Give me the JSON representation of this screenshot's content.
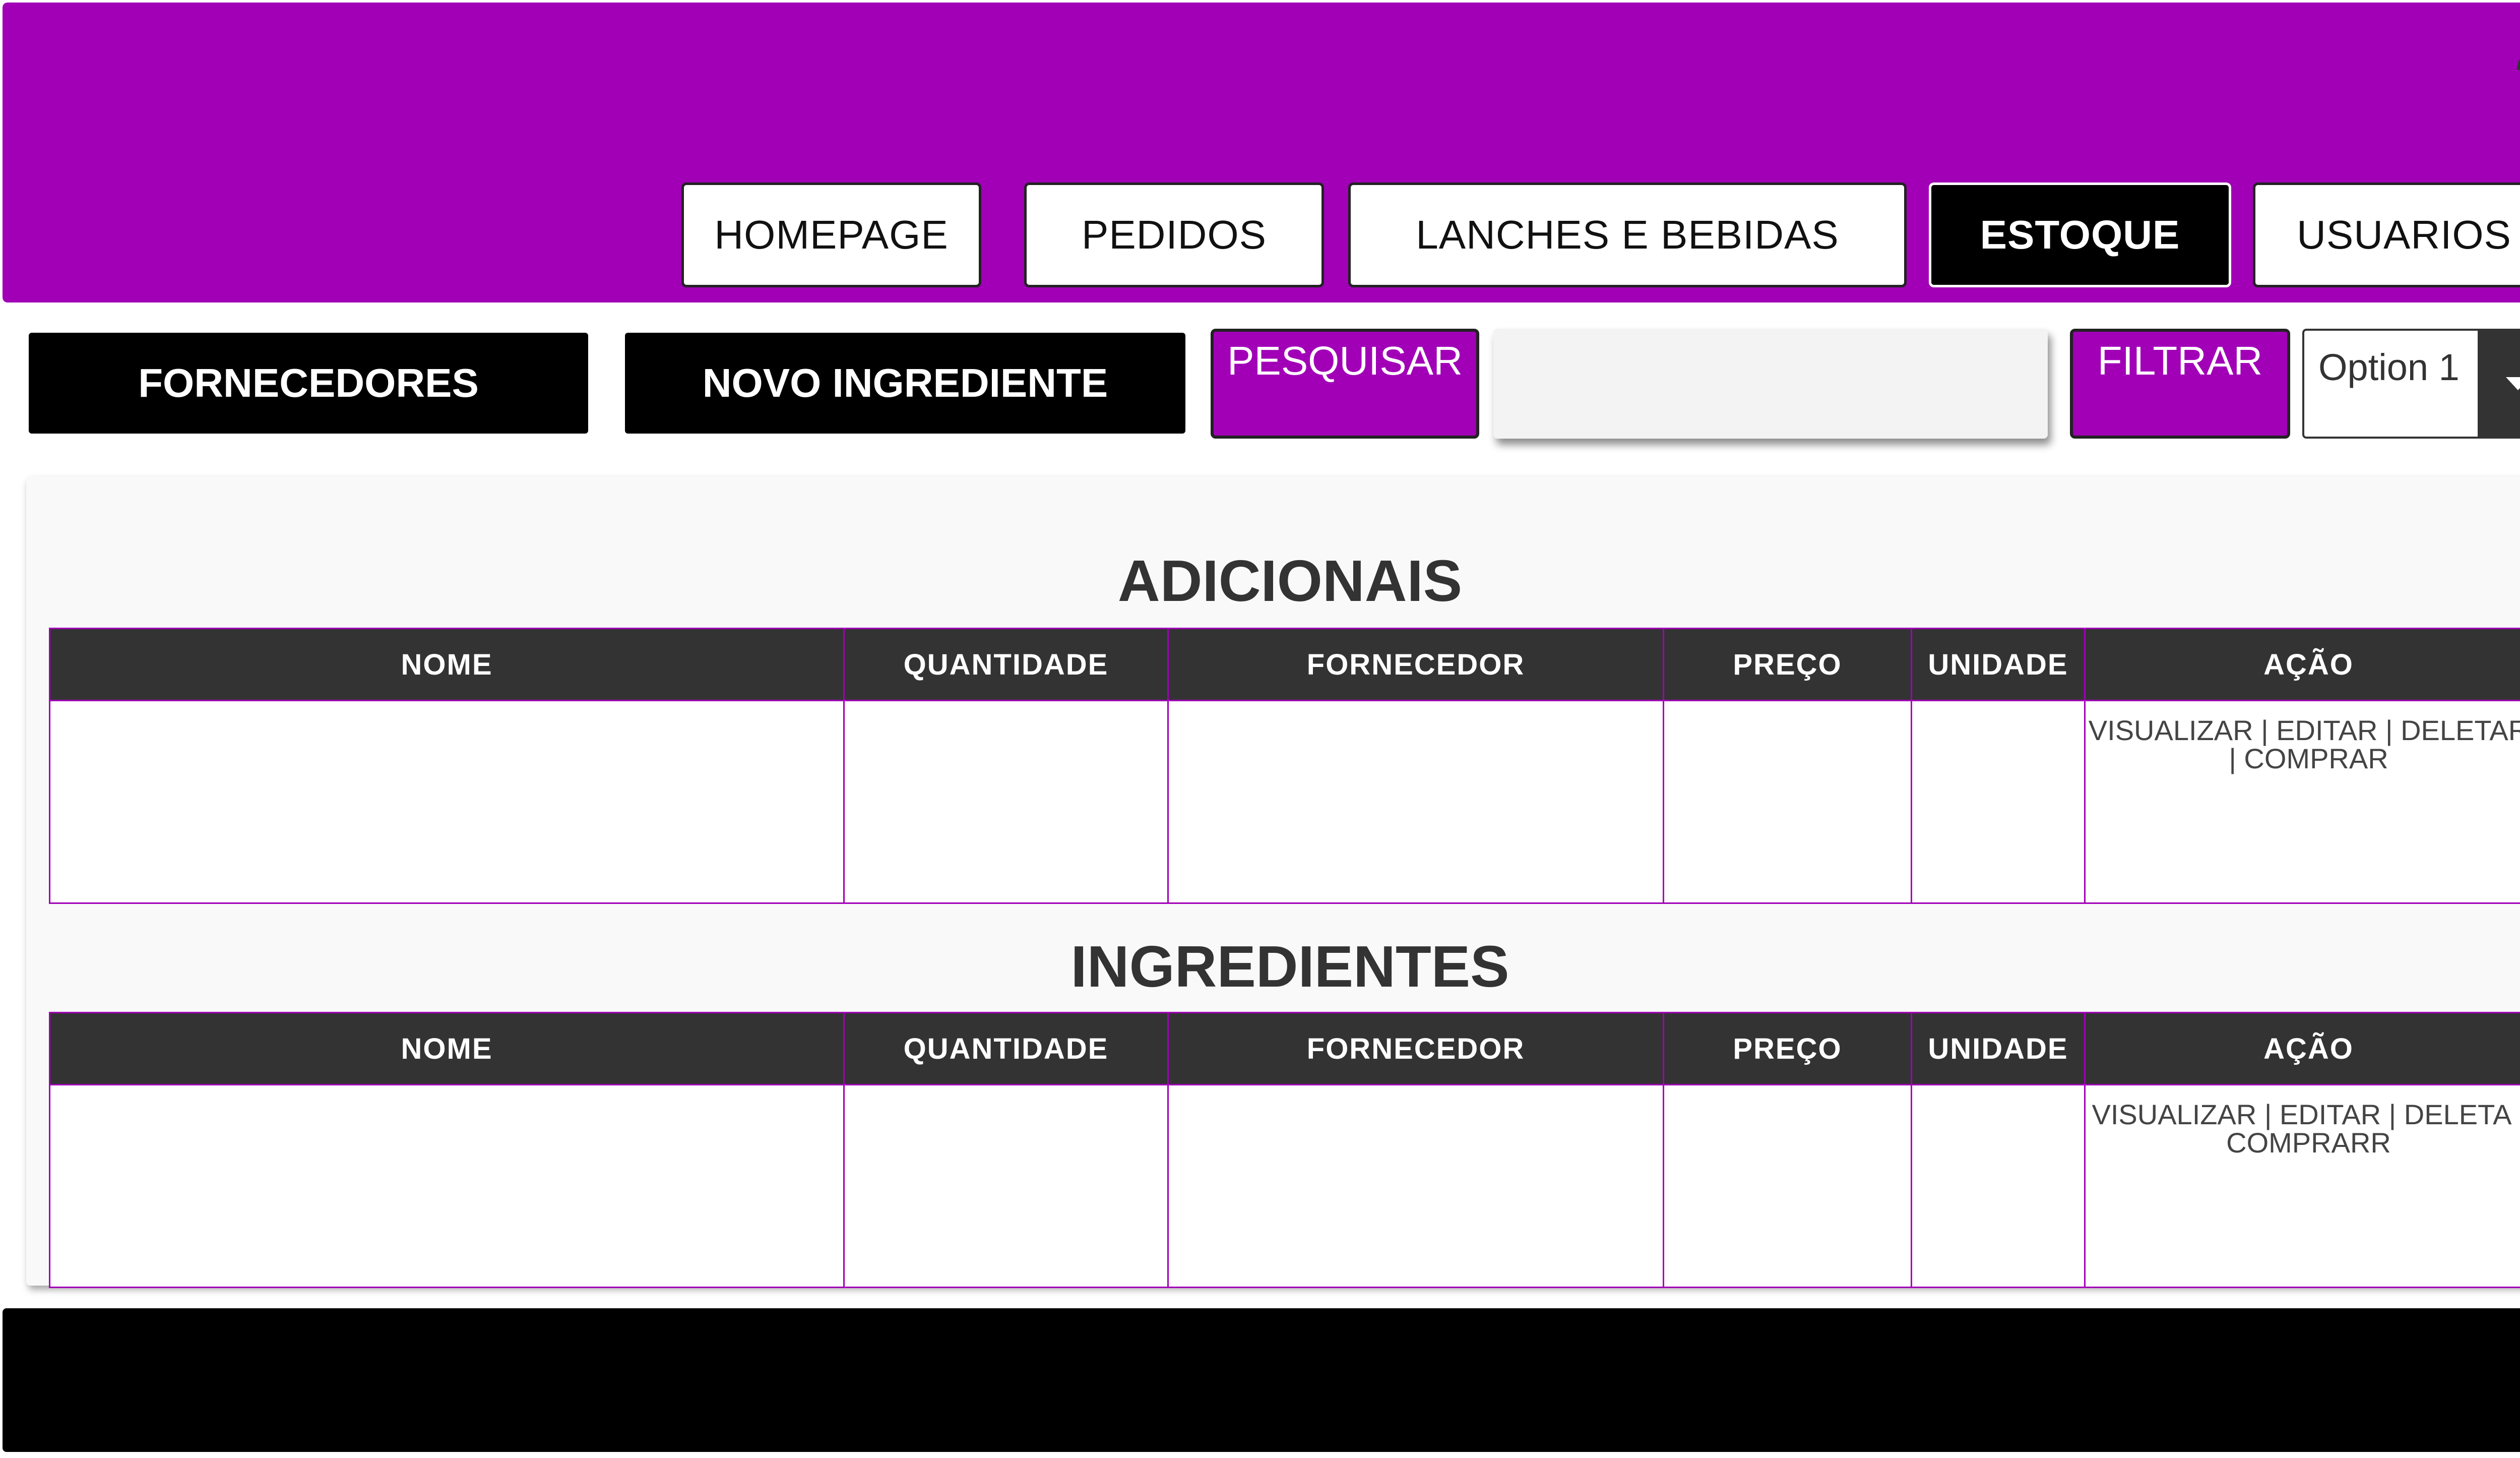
{
  "header": {
    "nav": [
      {
        "label": "HOMEPAGE",
        "active": false
      },
      {
        "label": "PEDIDOS",
        "active": false
      },
      {
        "label": "LANCHES E BEBIDAS",
        "active": false
      },
      {
        "label": "ESTOQUE",
        "active": true
      },
      {
        "label": "USUARIOS",
        "active": false
      }
    ],
    "user_icon": "user-icon"
  },
  "toolbar": {
    "fornecedores_label": "FORNECEDORES",
    "novo_ingrediente_label": "NOVO INGREDIENTE",
    "pesquisar_label": "PESQUISAR",
    "search_value": "",
    "filtrar_label": "FILTRAR",
    "filter_select": {
      "selected": "Option 1"
    }
  },
  "sections": [
    {
      "title": "ADICIONAIS",
      "columns": [
        "NOME",
        "QUANTIDADE",
        "FORNECEDOR",
        "PREÇO",
        "UNIDADE",
        "AÇÃO"
      ],
      "rows": [
        {
          "nome": "",
          "quantidade": "",
          "fornecedor": "",
          "preco": "",
          "unidade": "",
          "acao": "VISUALIZAR | EDITAR | DELETAR | COMPRAR"
        }
      ]
    },
    {
      "title": "INGREDIENTES",
      "columns": [
        "NOME",
        "QUANTIDADE",
        "FORNECEDOR",
        "PREÇO",
        "UNIDADE",
        "AÇÃO"
      ],
      "rows": [
        {
          "nome": "",
          "quantidade": "",
          "fornecedor": "",
          "preco": "",
          "unidade": "",
          "acao": "VISUALIZAR | EDITAR | DELETA | COMPRARR"
        }
      ]
    }
  ],
  "colors": {
    "brand_purple": "#a100b7",
    "dark": "#333333",
    "black": "#000000"
  }
}
